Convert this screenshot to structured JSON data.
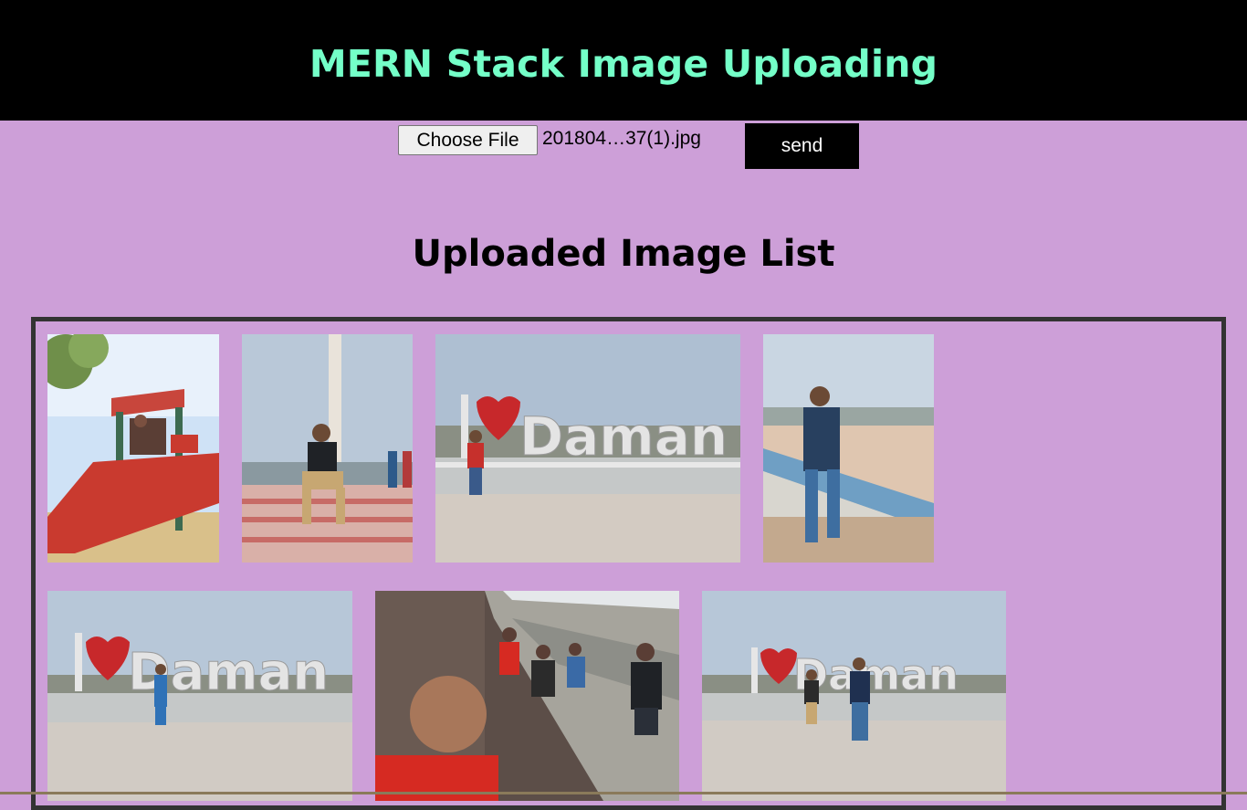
{
  "header": {
    "title": "MERN Stack Image Uploading"
  },
  "upload_form": {
    "choose_file_label": "Choose File",
    "selected_file_name": "201804…37(1).jpg",
    "send_label": "send"
  },
  "gallery": {
    "title": "Uploaded Image List",
    "images": [
      {
        "name": "photo-playground-slide",
        "scene": "playground",
        "sign_text": ""
      },
      {
        "name": "photo-man-sitting-steps",
        "scene": "steps",
        "sign_text": ""
      },
      {
        "name": "photo-i-love-daman-sign",
        "scene": "daman",
        "sign_text": "Daman"
      },
      {
        "name": "photo-man-on-wall",
        "scene": "wall",
        "sign_text": ""
      },
      {
        "name": "photo-i-love-daman-woman",
        "scene": "daman",
        "sign_text": "Daman"
      },
      {
        "name": "photo-beach-selfie",
        "scene": "beach",
        "sign_text": ""
      },
      {
        "name": "photo-i-love-daman-two-men",
        "scene": "daman",
        "sign_text": "Daman"
      }
    ]
  },
  "colors": {
    "page_background": "#cd9fd8",
    "header_background": "#000000",
    "header_text": "#74ffc8",
    "gallery_border": "#333333"
  }
}
